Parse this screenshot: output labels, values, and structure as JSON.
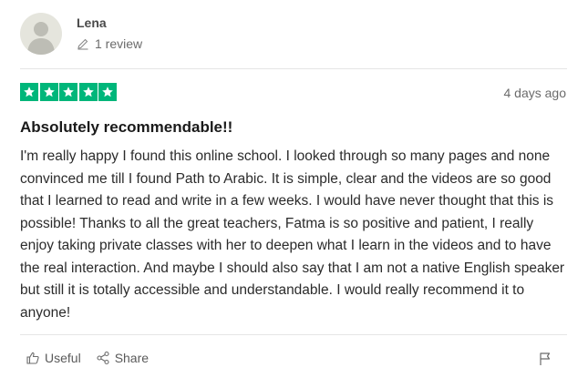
{
  "reviewer": {
    "name": "Lena",
    "review_count": "1 review"
  },
  "review": {
    "rating": 5,
    "rating_max": 5,
    "star_color": "#00b67a",
    "date": "4 days ago",
    "title": "Absolutely recommendable!!",
    "body": "I'm really happy I found this online school. I looked through so many pages and none convinced me till I found Path to Arabic. It is simple, clear and the videos are so good that I learned to read and write in a few weeks. I would have never thought that this is possible! Thanks to all the great teachers, Fatma is so positive and patient, I really enjoy taking private classes with her to deepen what I learn in the videos and to have the real interaction. And maybe I should also say that I am not a native English speaker but still it is totally accessible and understandable. I would really recommend it to anyone!"
  },
  "actions": {
    "useful_label": "Useful",
    "share_label": "Share"
  },
  "icons": {
    "avatar": "user-silhouette-icon",
    "review_count": "pencil-icon",
    "useful": "thumbs-up-icon",
    "share": "share-icon",
    "report": "flag-icon"
  }
}
